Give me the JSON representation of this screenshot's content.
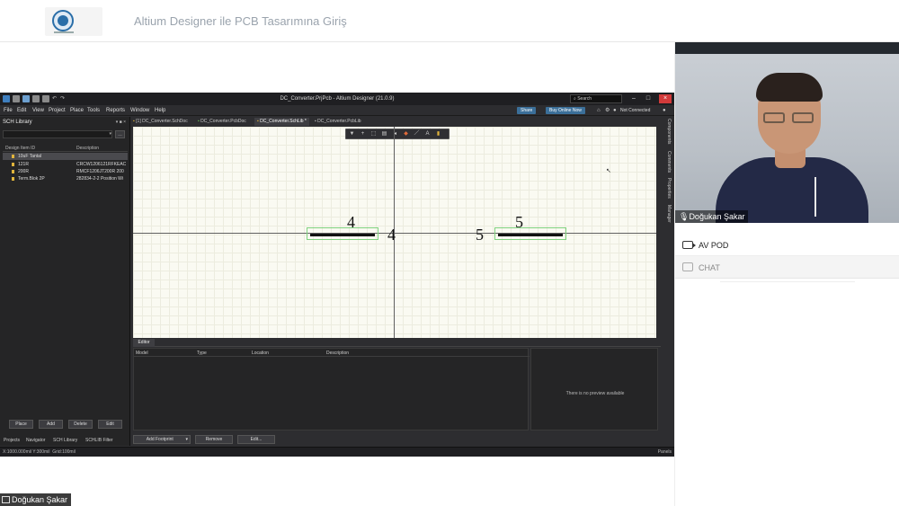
{
  "course": {
    "title": "Altium Designer ile PCB Tasarımına Giriş"
  },
  "app": {
    "title": "DC_Converter.PrjPcb - Altium Designer (21.0.9)",
    "search_placeholder": "Search",
    "menu": [
      "File",
      "Edit",
      "View",
      "Project",
      "Place",
      "Tools",
      "Reports",
      "Window",
      "Help"
    ],
    "share_label": "Share",
    "buy_label": "Buy Online Now",
    "connection_status": "Not Connected"
  },
  "left_panel": {
    "title": "SCH Library",
    "col_id": "Design Item ID",
    "col_desc": "Description",
    "items": [
      {
        "id": "10uF Tantal",
        "desc": ""
      },
      {
        "id": "121R",
        "desc": "CRCW1206121RFKEAC"
      },
      {
        "id": "200R",
        "desc": "RMCF1206JT200R 200"
      },
      {
        "id": "Term.Blok 2P",
        "desc": "282834-2-2 Position Wi"
      }
    ],
    "buttons": [
      "Place",
      "Add",
      "Delete",
      "Edit"
    ],
    "panel_tabs": [
      "Projects",
      "Navigator",
      "SCH Library",
      "SCHLIB Filter"
    ]
  },
  "doc_tabs": [
    "[1] DC_Converter.SchDoc",
    "DC_Converter.PcbDoc",
    "DC_Converter.SchLib *",
    "DC_Converter.PcbLib"
  ],
  "canvas": {
    "pin_left_label": "4",
    "pin_left_num": "4",
    "pin_right_label": "5",
    "pin_right_num": "5"
  },
  "right_tabs": [
    "Components",
    "Comments",
    "Properties",
    "Manager"
  ],
  "editor": {
    "tab_label": "Editor",
    "columns": [
      "Model",
      "Type",
      "Location",
      "Description"
    ],
    "preview_text": "There is no preview available",
    "buttons": {
      "add_footprint": "Add Footprint",
      "remove": "Remove",
      "edit": "Edit..."
    }
  },
  "status": {
    "coords": "X:1000.000mil Y:300mil",
    "grid": "Grid:100mil",
    "panels": "Panels"
  },
  "meeting": {
    "presenter_name": "Doğukan Şakar",
    "av_pod_label": "AV POD",
    "chat_label": "CHAT"
  }
}
